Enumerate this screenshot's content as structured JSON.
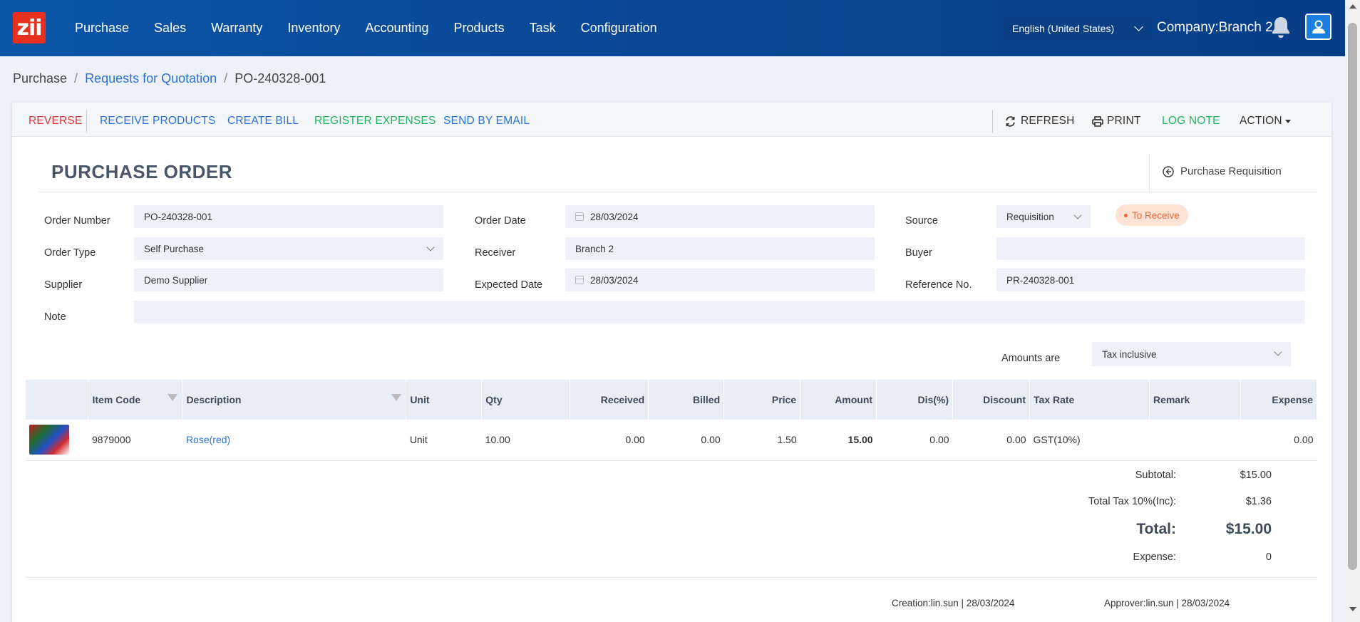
{
  "app": {
    "logo_text": "zii",
    "nav": [
      "Purchase",
      "Sales",
      "Warranty",
      "Inventory",
      "Accounting",
      "Products",
      "Task",
      "Configuration"
    ],
    "language": "English (United States)",
    "company": "Company:Branch 2"
  },
  "breadcrumb": {
    "root": "Purchase",
    "parent": "Requests for Quotation",
    "current": "PO-240328-001"
  },
  "toolbar": {
    "reverse": "REVERSE",
    "receive_products": "RECEIVE PRODUCTS",
    "create_bill": "CREATE BILL",
    "register_expenses": "REGISTER EXPENSES",
    "send_by_email": "SEND BY EMAIL",
    "refresh": "REFRESH",
    "print": "PRINT",
    "log_note": "LOG NOTE",
    "action": "ACTION"
  },
  "form": {
    "title": "PURCHASE ORDER",
    "purchase_requisition": "Purchase Requisition",
    "order_number_label": "Order Number",
    "order_number": "PO-240328-001",
    "order_type_label": "Order Type",
    "order_type": "Self Purchase",
    "supplier_label": "Supplier",
    "supplier": "Demo Supplier",
    "note_label": "Note",
    "note": "",
    "order_date_label": "Order Date",
    "order_date": "28/03/2024",
    "receiver_label": "Receiver",
    "receiver": "Branch 2",
    "expected_date_label": "Expected Date",
    "expected_date": "28/03/2024",
    "source_label": "Source",
    "source": "Requisition",
    "status": "To Receive",
    "buyer_label": "Buyer",
    "buyer": "",
    "reference_label": "Reference No.",
    "reference": "PR-240328-001"
  },
  "amounts": {
    "label": "Amounts are",
    "value": "Tax inclusive"
  },
  "table": {
    "headers": [
      "Item Code",
      "Description",
      "Unit",
      "Qty",
      "Received",
      "Billed",
      "Price",
      "Amount",
      "Dis(%)",
      "Discount",
      "Tax Rate",
      "Remark",
      "Expense"
    ],
    "rows": [
      {
        "code": "9879000",
        "description": "Rose(red)",
        "unit": "Unit",
        "qty": "10.00",
        "received": "0.00",
        "billed": "0.00",
        "price": "1.50",
        "amount": "15.00",
        "dis_pct": "0.00",
        "discount": "0.00",
        "tax_rate": "GST(10%)",
        "remark": "",
        "expense": "0.00"
      }
    ]
  },
  "totals": {
    "subtotal_label": "Subtotal:",
    "subtotal": "$15.00",
    "tax_label": "Total Tax 10%(Inc):",
    "tax": "$1.36",
    "total_label": "Total:",
    "total": "$15.00",
    "expense_label": "Expense:",
    "expense": "0"
  },
  "footer": {
    "creation": "Creation:lin.sun | 28/03/2024",
    "approver": "Approver:lin.sun | 28/03/2024"
  },
  "colors": {
    "nav_bg": "#0a4a98",
    "reverse": "#e0333c",
    "link": "#2a72d6",
    "green": "#20b463",
    "status_bg": "#fde3d4",
    "status_text": "#e8683a"
  }
}
